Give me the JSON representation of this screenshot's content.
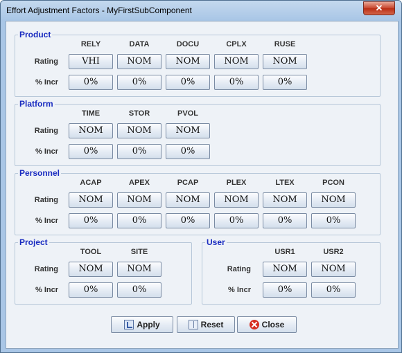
{
  "window": {
    "title": "Effort Adjustment Factors - MyFirstSubComponent",
    "close_label": "✕"
  },
  "row_labels": {
    "rating": "Rating",
    "incr": "% Incr"
  },
  "groups": {
    "product": {
      "title": "Product",
      "factors": [
        {
          "code": "RELY",
          "rating": "VHI",
          "incr": "0%"
        },
        {
          "code": "DATA",
          "rating": "NOM",
          "incr": "0%"
        },
        {
          "code": "DOCU",
          "rating": "NOM",
          "incr": "0%"
        },
        {
          "code": "CPLX",
          "rating": "NOM",
          "incr": "0%"
        },
        {
          "code": "RUSE",
          "rating": "NOM",
          "incr": "0%"
        }
      ]
    },
    "platform": {
      "title": "Platform",
      "factors": [
        {
          "code": "TIME",
          "rating": "NOM",
          "incr": "0%"
        },
        {
          "code": "STOR",
          "rating": "NOM",
          "incr": "0%"
        },
        {
          "code": "PVOL",
          "rating": "NOM",
          "incr": "0%"
        }
      ]
    },
    "personnel": {
      "title": "Personnel",
      "factors": [
        {
          "code": "ACAP",
          "rating": "NOM",
          "incr": "0%"
        },
        {
          "code": "APEX",
          "rating": "NOM",
          "incr": "0%"
        },
        {
          "code": "PCAP",
          "rating": "NOM",
          "incr": "0%"
        },
        {
          "code": "PLEX",
          "rating": "NOM",
          "incr": "0%"
        },
        {
          "code": "LTEX",
          "rating": "NOM",
          "incr": "0%"
        },
        {
          "code": "PCON",
          "rating": "NOM",
          "incr": "0%"
        }
      ]
    },
    "project": {
      "title": "Project",
      "factors": [
        {
          "code": "TOOL",
          "rating": "NOM",
          "incr": "0%"
        },
        {
          "code": "SITE",
          "rating": "NOM",
          "incr": "0%"
        }
      ]
    },
    "user": {
      "title": "User",
      "factors": [
        {
          "code": "USR1",
          "rating": "NOM",
          "incr": "0%"
        },
        {
          "code": "USR2",
          "rating": "NOM",
          "incr": "0%"
        }
      ]
    }
  },
  "actions": {
    "apply": "Apply",
    "reset": "Reset",
    "close": "Close"
  }
}
